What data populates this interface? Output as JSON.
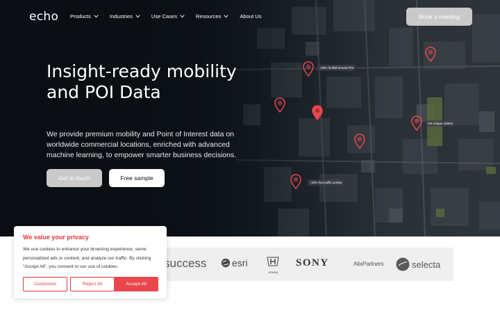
{
  "nav": {
    "logo": "echo",
    "items": [
      {
        "label": "Products",
        "has_dropdown": true
      },
      {
        "label": "Industries",
        "has_dropdown": true
      },
      {
        "label": "Use Cases",
        "has_dropdown": true
      },
      {
        "label": "Resources",
        "has_dropdown": true
      },
      {
        "label": "About Us",
        "has_dropdown": false
      }
    ],
    "cta": "Book a meeting"
  },
  "hero": {
    "title": "Insight-ready mobility and POI Data",
    "description": "We provide premium mobility and Point of Interest data on worldwide commercial locations, enriched with advanced machine learning, to empower smarter business decisions.",
    "primary_button": "Get in touch",
    "secondary_button": "Free sample"
  },
  "map": {
    "labels": [
      "+23% footfall around POI",
      "-5% unique visitors",
      "+23% foot traffic activity"
    ],
    "pin_color": "#e9474e"
  },
  "logos": [
    "success",
    "esri",
    "HONDA",
    "SONY",
    "AlixPartners",
    "selecta"
  ],
  "cookie": {
    "title": "We value your privacy",
    "text": "We use cookies to enhance your browsing experience, serve personalized ads or content, and analyze our traffic. By clicking \"Accept All\", you consent to our use of cookies.",
    "customize": "Customize",
    "reject": "Reject All",
    "accept": "Accept All"
  },
  "colors": {
    "accent": "#e3363d",
    "hero_dark": "#0f151b",
    "muted_button": "#c9c9c9"
  }
}
